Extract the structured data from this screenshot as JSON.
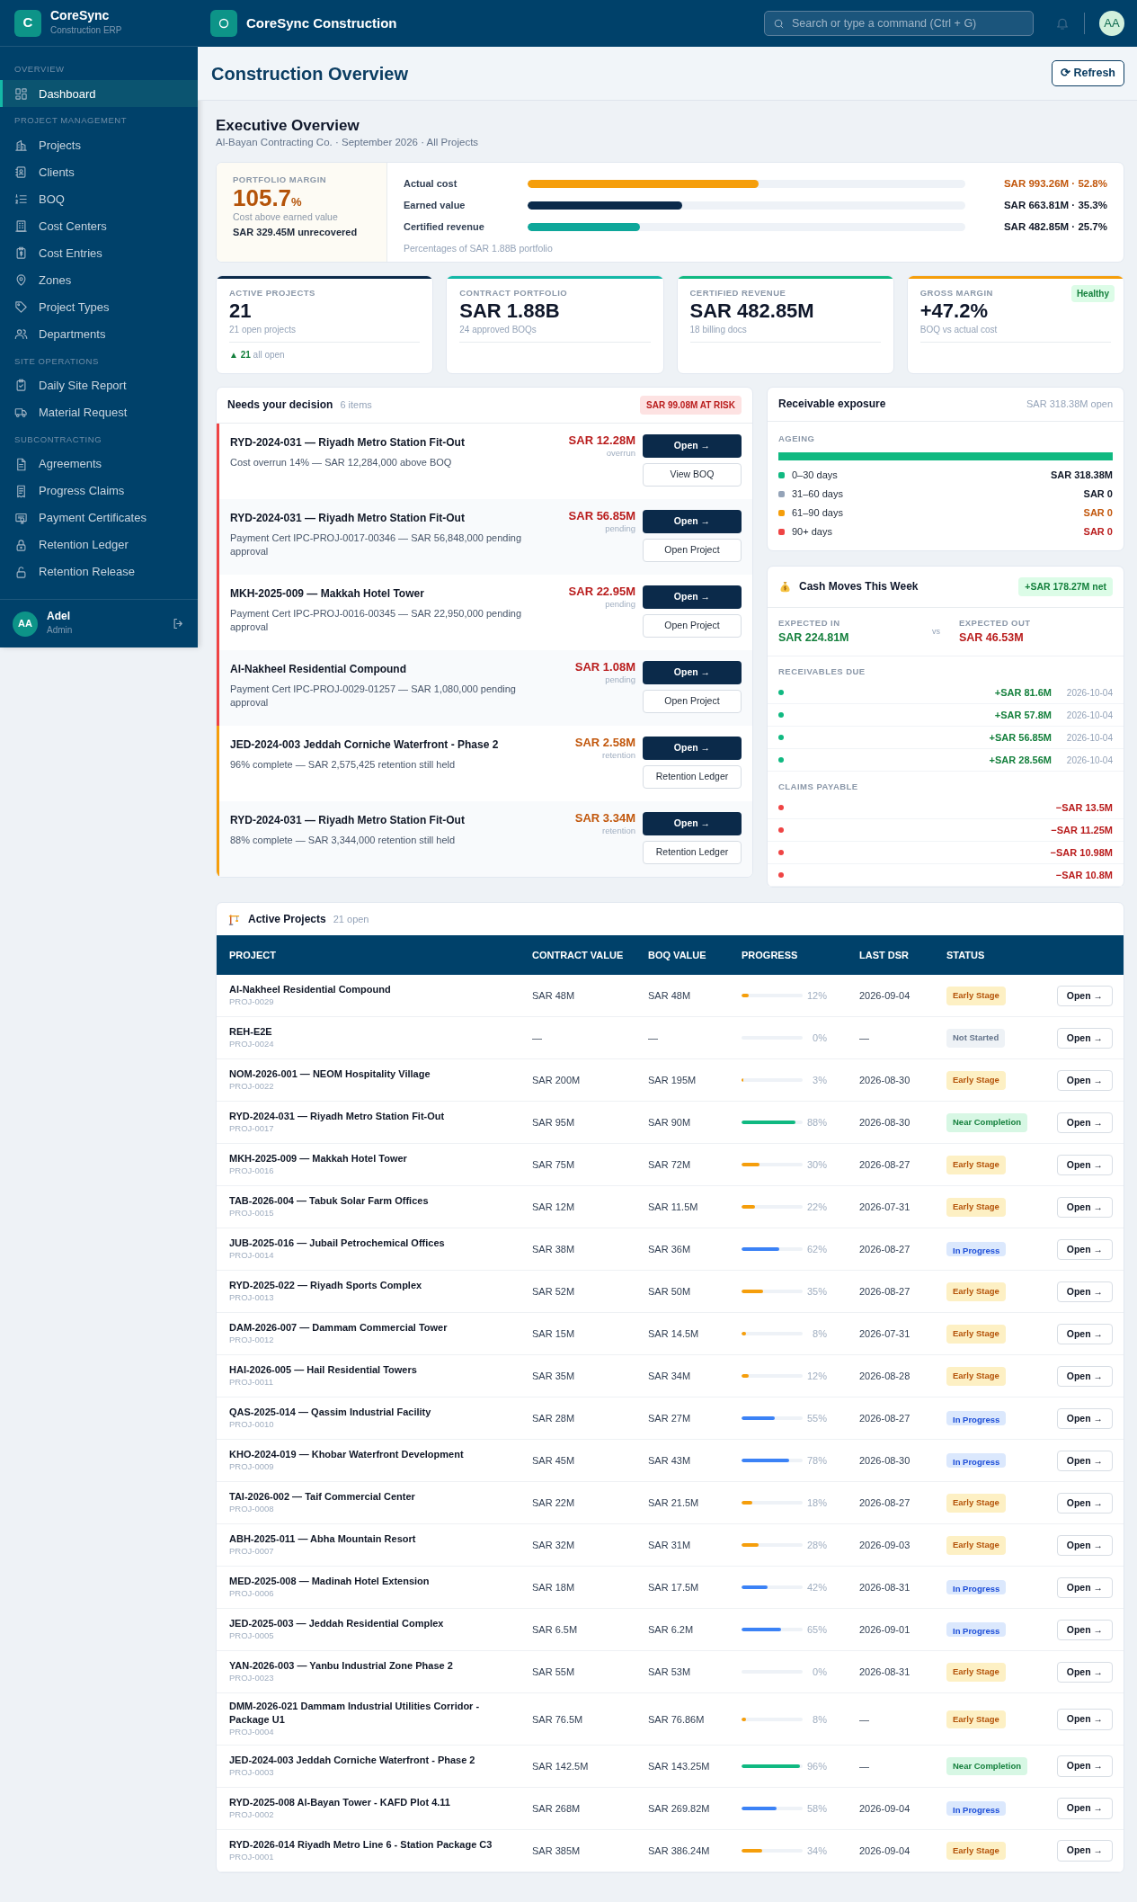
{
  "sidebar": {
    "brand": {
      "logo": "C",
      "name": "CoreSync",
      "subtitle": "Construction ERP"
    },
    "sections": [
      {
        "title": "OVERVIEW",
        "items": [
          {
            "label": "Dashboard",
            "selected": true
          }
        ]
      },
      {
        "title": "PROJECT MANAGEMENT",
        "items": [
          {
            "label": "Projects",
            "selected": false
          },
          {
            "label": "Clients",
            "selected": false
          },
          {
            "label": "BOQ",
            "selected": false
          },
          {
            "label": "Cost Centers",
            "selected": false
          },
          {
            "label": "Cost Entries",
            "selected": false
          },
          {
            "label": "Zones",
            "selected": false
          },
          {
            "label": "Project Types",
            "selected": false
          },
          {
            "label": "Departments",
            "selected": false
          }
        ]
      },
      {
        "title": "SITE OPERATIONS",
        "items": [
          {
            "label": "Daily Site Report",
            "selected": false
          },
          {
            "label": "Material Request",
            "selected": false
          }
        ]
      },
      {
        "title": "SUBCONTRACTING",
        "items": [
          {
            "label": "Agreements",
            "selected": false
          },
          {
            "label": "Progress Claims",
            "selected": false
          },
          {
            "label": "Payment Certificates",
            "selected": false
          },
          {
            "label": "Retention Ledger",
            "selected": false
          },
          {
            "label": "Retention Release",
            "selected": false
          }
        ]
      }
    ],
    "user": {
      "initials": "AA",
      "name": "Adel",
      "role": "Admin"
    }
  },
  "topbar": {
    "title": "CoreSync Construction",
    "search": {
      "placeholder": "Search or type a command (Ctrl + G)"
    },
    "avatar": "AA"
  },
  "page": {
    "title": "Construction Overview",
    "refresh": "⟳ Refresh"
  },
  "overview": {
    "title": "Executive Overview",
    "subtitle": "Al-Bayan Contracting Co. · September 2026 · All Projects",
    "margin": {
      "label": "PORTFOLIO MARGIN",
      "value": "105.7",
      "unit": "%",
      "note": "Cost above earned value",
      "amount": "SAR 329.45M unrecovered"
    },
    "bars": [
      {
        "label": "Actual cost",
        "level": 0.528,
        "reading": "SAR 993.26M · 52.8%",
        "color": "#f59e0b",
        "kind": "warn"
      },
      {
        "label": "Earned value",
        "level": 0.353,
        "reading": "SAR 663.81M · 35.3%",
        "color": "#0b2a4a",
        "kind": "normal"
      },
      {
        "label": "Certified revenue",
        "level": 0.257,
        "reading": "SAR 482.85M · 25.7%",
        "color": "#0ea79a",
        "kind": "normal"
      }
    ],
    "footnote": "Percentages of SAR 1.88B portfolio"
  },
  "kpis": [
    {
      "label": "ACTIVE PROJECTS",
      "value": "21",
      "note": "21 open projects",
      "color": "#0b2a4a",
      "trend": {
        "arrow": "▲",
        "value": "21",
        "text": "all open"
      }
    },
    {
      "label": "CONTRACT PORTFOLIO",
      "value": "SAR 1.88B",
      "note": "24 approved BOQs",
      "color": "#14b8a6"
    },
    {
      "label": "CERTIFIED REVENUE",
      "value": "SAR 482.85M",
      "note": "18 billing docs",
      "color": "#10b981"
    },
    {
      "label": "GROSS MARGIN",
      "value": "+47.2%",
      "note": "BOQ vs actual cost",
      "color": "#f59e0b",
      "badge": "Healthy"
    }
  ],
  "decisions": {
    "title": "Needs your decision",
    "count": "6 items",
    "risk": "SAR 99.08M AT RISK",
    "items": [
      {
        "kind": "risk",
        "title": "RYD-2024-031 — Riyadh Metro Station Fit-Out",
        "detail": "Cost overrun 14% — SAR 12,284,000 above BOQ",
        "amount": "SAR 12.28M",
        "amount_note": "overrun",
        "primary": "Open →",
        "secondary": "View BOQ"
      },
      {
        "kind": "risk",
        "title": "RYD-2024-031 — Riyadh Metro Station Fit-Out",
        "detail": "Payment Cert IPC-PROJ-0017-00346 — SAR 56,848,000 pending approval",
        "amount": "SAR 56.85M",
        "amount_note": "pending",
        "primary": "Open →",
        "secondary": "Open Project"
      },
      {
        "kind": "risk",
        "title": "MKH-2025-009 — Makkah Hotel Tower",
        "detail": "Payment Cert IPC-PROJ-0016-00345 — SAR 22,950,000 pending approval",
        "amount": "SAR 22.95M",
        "amount_note": "pending",
        "primary": "Open →",
        "secondary": "Open Project"
      },
      {
        "kind": "risk",
        "title": "Al-Nakheel Residential Compound",
        "detail": "Payment Cert IPC-PROJ-0029-01257 — SAR 1,080,000 pending approval",
        "amount": "SAR 1.08M",
        "amount_note": "pending",
        "primary": "Open →",
        "secondary": "Open Project"
      },
      {
        "kind": "retention",
        "title": "JED-2024-003 Jeddah Corniche Waterfront - Phase 2",
        "detail": "96% complete — SAR 2,575,425 retention still held",
        "amount": "SAR 2.58M",
        "amount_note": "retention",
        "primary": "Open →",
        "secondary": "Retention Ledger"
      },
      {
        "kind": "retention",
        "title": "RYD-2024-031 — Riyadh Metro Station Fit-Out",
        "detail": "88% complete — SAR 3,344,000 retention still held",
        "amount": "SAR 3.34M",
        "amount_note": "retention",
        "primary": "Open →",
        "secondary": "Retention Ledger"
      }
    ]
  },
  "receivable": {
    "title": "Receivable exposure",
    "total": "SAR 318.38M open",
    "ageing_label": "AGEING",
    "bar": {
      "level": 1
    },
    "legend": [
      {
        "label": "0–30 days",
        "amount": "SAR 318.38M",
        "color": "#10b981",
        "kind": "normal"
      },
      {
        "label": "31–60 days",
        "amount": "SAR 0",
        "color": "#94a3b8",
        "kind": "normal"
      },
      {
        "label": "61–90 days",
        "amount": "SAR 0",
        "color": "#f59e0b",
        "kind": "warn"
      },
      {
        "label": "90+ days",
        "amount": "SAR 0",
        "color": "#ef4444",
        "kind": "danger"
      }
    ]
  },
  "cash": {
    "title": "Cash Moves This Week",
    "net": "+SAR 178.27M net",
    "in": {
      "label": "EXPECTED IN",
      "amount": "SAR 224.81M"
    },
    "vs": "vs",
    "out": {
      "label": "EXPECTED OUT",
      "amount": "SAR 46.53M"
    },
    "receivables": {
      "title": "RECEIVABLES DUE",
      "items": [
        {
          "amount": "+SAR 81.6M",
          "date": "2026-10-04"
        },
        {
          "amount": "+SAR 57.8M",
          "date": "2026-10-04"
        },
        {
          "amount": "+SAR 56.85M",
          "date": "2026-10-04"
        },
        {
          "amount": "+SAR 28.56M",
          "date": "2026-10-04"
        }
      ]
    },
    "claims": {
      "title": "CLAIMS PAYABLE",
      "items": [
        {
          "amount": "−SAR 13.5M"
        },
        {
          "amount": "−SAR 11.25M"
        },
        {
          "amount": "−SAR 10.98M"
        },
        {
          "amount": "−SAR 10.8M"
        }
      ]
    }
  },
  "projects": {
    "title": "Active Projects",
    "count": "21 open",
    "columns": [
      "PROJECT",
      "CONTRACT VALUE",
      "BOQ VALUE",
      "PROGRESS",
      "LAST DSR",
      "STATUS"
    ],
    "rows": [
      {
        "name": "Al-Nakheel Residential Compound",
        "code": "PROJ-0029",
        "contract": "SAR 48M",
        "boq": "SAR 48M",
        "level": 0.12,
        "progress": "12%",
        "last_dsr": "2026-09-04",
        "status": {
          "label": "Early Stage",
          "kind": "early"
        },
        "action": "Open →"
      },
      {
        "name": "REH-E2E",
        "code": "PROJ-0024",
        "contract": "—",
        "boq": "—",
        "level": 0,
        "progress": "0%",
        "last_dsr": "—",
        "status": {
          "label": "Not Started",
          "kind": "idle"
        },
        "action": "Open →"
      },
      {
        "name": "NOM-2026-001 — NEOM Hospitality Village",
        "code": "PROJ-0022",
        "contract": "SAR 200M",
        "boq": "SAR 195M",
        "level": 0.03,
        "progress": "3%",
        "last_dsr": "2026-08-30",
        "status": {
          "label": "Early Stage",
          "kind": "early"
        },
        "action": "Open →"
      },
      {
        "name": "RYD-2024-031 — Riyadh Metro Station Fit-Out",
        "code": "PROJ-0017",
        "contract": "SAR 95M",
        "boq": "SAR 90M",
        "level": 0.88,
        "progress": "88%",
        "last_dsr": "2026-08-30",
        "status": {
          "label": "Near Completion",
          "kind": "near"
        },
        "action": "Open →"
      },
      {
        "name": "MKH-2025-009 — Makkah Hotel Tower",
        "code": "PROJ-0016",
        "contract": "SAR 75M",
        "boq": "SAR 72M",
        "level": 0.3,
        "progress": "30%",
        "last_dsr": "2026-08-27",
        "status": {
          "label": "Early Stage",
          "kind": "early"
        },
        "action": "Open →"
      },
      {
        "name": "TAB-2026-004 — Tabuk Solar Farm Offices",
        "code": "PROJ-0015",
        "contract": "SAR 12M",
        "boq": "SAR 11.5M",
        "level": 0.22,
        "progress": "22%",
        "last_dsr": "2026-07-31",
        "status": {
          "label": "Early Stage",
          "kind": "early"
        },
        "action": "Open →"
      },
      {
        "name": "JUB-2025-016 — Jubail Petrochemical Offices",
        "code": "PROJ-0014",
        "contract": "SAR 38M",
        "boq": "SAR 36M",
        "level": 0.62,
        "progress": "62%",
        "last_dsr": "2026-08-27",
        "status": {
          "label": "In Progress",
          "kind": "progress"
        },
        "action": "Open →"
      },
      {
        "name": "RYD-2025-022 — Riyadh Sports Complex",
        "code": "PROJ-0013",
        "contract": "SAR 52M",
        "boq": "SAR 50M",
        "level": 0.35,
        "progress": "35%",
        "last_dsr": "2026-08-27",
        "status": {
          "label": "Early Stage",
          "kind": "early"
        },
        "action": "Open →"
      },
      {
        "name": "DAM-2026-007 — Dammam Commercial Tower",
        "code": "PROJ-0012",
        "contract": "SAR 15M",
        "boq": "SAR 14.5M",
        "level": 0.08,
        "progress": "8%",
        "last_dsr": "2026-07-31",
        "status": {
          "label": "Early Stage",
          "kind": "early"
        },
        "action": "Open →"
      },
      {
        "name": "HAI-2026-005 — Hail Residential Towers",
        "code": "PROJ-0011",
        "contract": "SAR 35M",
        "boq": "SAR 34M",
        "level": 0.12,
        "progress": "12%",
        "last_dsr": "2026-08-28",
        "status": {
          "label": "Early Stage",
          "kind": "early"
        },
        "action": "Open →"
      },
      {
        "name": "QAS-2025-014 — Qassim Industrial Facility",
        "code": "PROJ-0010",
        "contract": "SAR 28M",
        "boq": "SAR 27M",
        "level": 0.55,
        "progress": "55%",
        "last_dsr": "2026-08-27",
        "status": {
          "label": "In Progress",
          "kind": "progress"
        },
        "action": "Open →"
      },
      {
        "name": "KHO-2024-019 — Khobar Waterfront Development",
        "code": "PROJ-0009",
        "contract": "SAR 45M",
        "boq": "SAR 43M",
        "level": 0.78,
        "progress": "78%",
        "last_dsr": "2026-08-30",
        "status": {
          "label": "In Progress",
          "kind": "progress"
        },
        "action": "Open →"
      },
      {
        "name": "TAI-2026-002 — Taif Commercial Center",
        "code": "PROJ-0008",
        "contract": "SAR 22M",
        "boq": "SAR 21.5M",
        "level": 0.18,
        "progress": "18%",
        "last_dsr": "2026-08-27",
        "status": {
          "label": "Early Stage",
          "kind": "early"
        },
        "action": "Open →"
      },
      {
        "name": "ABH-2025-011 — Abha Mountain Resort",
        "code": "PROJ-0007",
        "contract": "SAR 32M",
        "boq": "SAR 31M",
        "level": 0.28,
        "progress": "28%",
        "last_dsr": "2026-09-03",
        "status": {
          "label": "Early Stage",
          "kind": "early"
        },
        "action": "Open →"
      },
      {
        "name": "MED-2025-008 — Madinah Hotel Extension",
        "code": "PROJ-0006",
        "contract": "SAR 18M",
        "boq": "SAR 17.5M",
        "level": 0.42,
        "progress": "42%",
        "last_dsr": "2026-08-31",
        "status": {
          "label": "In Progress",
          "kind": "progress"
        },
        "action": "Open →"
      },
      {
        "name": "JED-2025-003 — Jeddah Residential Complex",
        "code": "PROJ-0005",
        "contract": "SAR 6.5M",
        "boq": "SAR 6.2M",
        "level": 0.65,
        "progress": "65%",
        "last_dsr": "2026-09-01",
        "status": {
          "label": "In Progress",
          "kind": "progress"
        },
        "action": "Open →"
      },
      {
        "name": "YAN-2026-003 — Yanbu Industrial Zone Phase 2",
        "code": "PROJ-0023",
        "contract": "SAR 55M",
        "boq": "SAR 53M",
        "level": 0,
        "progress": "0%",
        "last_dsr": "2026-08-31",
        "status": {
          "label": "Early Stage",
          "kind": "early"
        },
        "action": "Open →"
      },
      {
        "name": "DMM-2026-021 Dammam Industrial Utilities Corridor - Package U1",
        "code": "PROJ-0004",
        "contract": "SAR 76.5M",
        "boq": "SAR 76.86M",
        "level": 0.08,
        "progress": "8%",
        "last_dsr": "—",
        "status": {
          "label": "Early Stage",
          "kind": "early"
        },
        "action": "Open →"
      },
      {
        "name": "JED-2024-003 Jeddah Corniche Waterfront - Phase 2",
        "code": "PROJ-0003",
        "contract": "SAR 142.5M",
        "boq": "SAR 143.25M",
        "level": 0.96,
        "progress": "96%",
        "last_dsr": "—",
        "status": {
          "label": "Near Completion",
          "kind": "near"
        },
        "action": "Open →"
      },
      {
        "name": "RYD-2025-008 Al-Bayan Tower - KAFD Plot 4.11",
        "code": "PROJ-0002",
        "contract": "SAR 268M",
        "boq": "SAR 269.82M",
        "level": 0.58,
        "progress": "58%",
        "last_dsr": "2026-09-04",
        "status": {
          "label": "In Progress",
          "kind": "progress"
        },
        "action": "Open →"
      },
      {
        "name": "RYD-2026-014 Riyadh Metro Line 6 - Station Package C3",
        "code": "PROJ-0001",
        "contract": "SAR 385M",
        "boq": "SAR 386.24M",
        "level": 0.34,
        "progress": "34%",
        "last_dsr": "2026-09-04",
        "status": {
          "label": "Early Stage",
          "kind": "early"
        },
        "action": "Open →"
      }
    ]
  }
}
